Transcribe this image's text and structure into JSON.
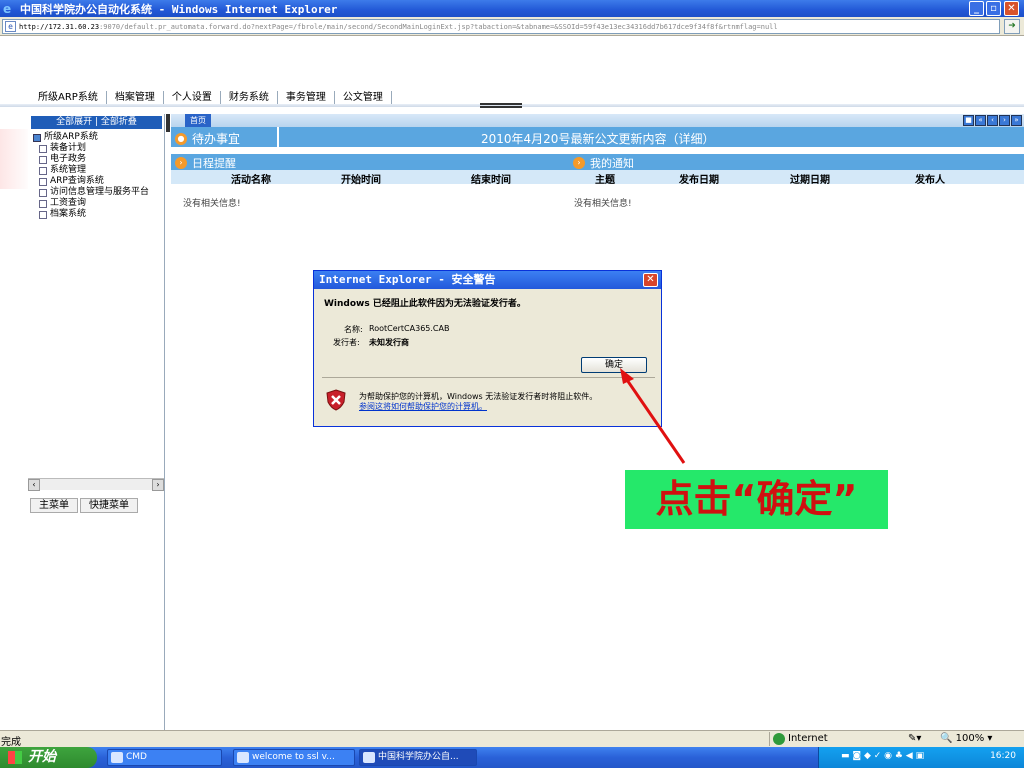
{
  "window": {
    "title": "中国科学院办公自动化系统 - Windows Internet Explorer",
    "address_host": "http://172.31.60.23",
    "address_path": ":9070/default.pr_automata.forward.do?nextPage=/fbrole/main/second/SecondMainLoginExt.jsp?tabaction=&tabname=&SSOId=59f43e13ec34316dd7b617dce9f34f8f&rtnmflag=null"
  },
  "nav": {
    "items": [
      "所级ARP系统",
      "档案管理",
      "个人设置",
      "财务系统",
      "事务管理",
      "公文管理"
    ]
  },
  "sidebar": {
    "header": "全部展开 | 全部折叠",
    "root": "所级ARP系统",
    "items": [
      "装备计划",
      "电子政务",
      "系统管理",
      "ARP查询系统",
      "访问信息管理与服务平台",
      "工资查询",
      "档案系统"
    ],
    "tab_main": "主菜单",
    "tab_quick": "快捷菜单"
  },
  "main": {
    "home_tab": "首页",
    "todo": "待办事宜",
    "news": "2010年4月20号最新公文更新内容（详细）",
    "schedule": "日程提醒",
    "notice": "我的通知",
    "schedule_cols": [
      "活动名称",
      "开始时间",
      "结束时间"
    ],
    "notice_cols": [
      "主题",
      "发布日期",
      "过期日期",
      "发布人"
    ],
    "empty_left": "没有相关信息!",
    "empty_right": "没有相关信息!"
  },
  "dialog": {
    "title": "Internet Explorer - 安全警告",
    "message": "Windows 已经阻止此软件因为无法验证发行者。",
    "name_label": "名称:",
    "name_value": "RootCertCA365.CAB",
    "publisher_label": "发行者:",
    "publisher_value": "未知发行商",
    "ok": "确定",
    "warning": "为帮助保护您的计算机，Windows 无法验证发行者时将阻止软件。",
    "link": "参阅这将如何帮助保护您的计算机。"
  },
  "annotation": {
    "callout": "点击“确定”",
    "color": "#d01010",
    "bg": "#25e86a"
  },
  "status": {
    "left": "完成",
    "zone": "Internet",
    "zoom": "100%"
  },
  "taskbar": {
    "start": "开始",
    "tasks": [
      "CMD",
      "welcome to ssl v...",
      "中国科学院办公自..."
    ],
    "clock": "16:20"
  }
}
